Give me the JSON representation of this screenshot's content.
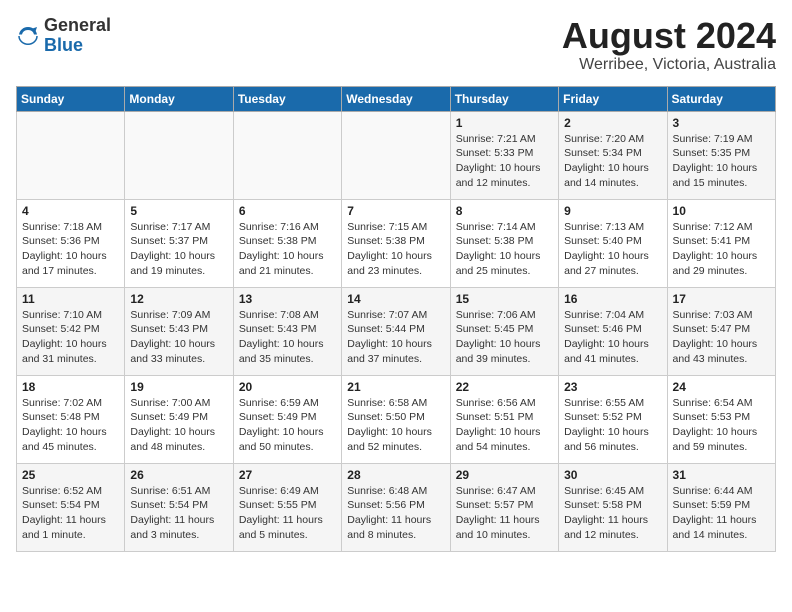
{
  "logo": {
    "general": "General",
    "blue": "Blue"
  },
  "header": {
    "month": "August 2024",
    "location": "Werribee, Victoria, Australia"
  },
  "weekdays": [
    "Sunday",
    "Monday",
    "Tuesday",
    "Wednesday",
    "Thursday",
    "Friday",
    "Saturday"
  ],
  "weeks": [
    [
      {
        "day": "",
        "info": ""
      },
      {
        "day": "",
        "info": ""
      },
      {
        "day": "",
        "info": ""
      },
      {
        "day": "",
        "info": ""
      },
      {
        "day": "1",
        "info": "Sunrise: 7:21 AM\nSunset: 5:33 PM\nDaylight: 10 hours\nand 12 minutes."
      },
      {
        "day": "2",
        "info": "Sunrise: 7:20 AM\nSunset: 5:34 PM\nDaylight: 10 hours\nand 14 minutes."
      },
      {
        "day": "3",
        "info": "Sunrise: 7:19 AM\nSunset: 5:35 PM\nDaylight: 10 hours\nand 15 minutes."
      }
    ],
    [
      {
        "day": "4",
        "info": "Sunrise: 7:18 AM\nSunset: 5:36 PM\nDaylight: 10 hours\nand 17 minutes."
      },
      {
        "day": "5",
        "info": "Sunrise: 7:17 AM\nSunset: 5:37 PM\nDaylight: 10 hours\nand 19 minutes."
      },
      {
        "day": "6",
        "info": "Sunrise: 7:16 AM\nSunset: 5:38 PM\nDaylight: 10 hours\nand 21 minutes."
      },
      {
        "day": "7",
        "info": "Sunrise: 7:15 AM\nSunset: 5:38 PM\nDaylight: 10 hours\nand 23 minutes."
      },
      {
        "day": "8",
        "info": "Sunrise: 7:14 AM\nSunset: 5:38 PM\nDaylight: 10 hours\nand 25 minutes."
      },
      {
        "day": "9",
        "info": "Sunrise: 7:13 AM\nSunset: 5:40 PM\nDaylight: 10 hours\nand 27 minutes."
      },
      {
        "day": "10",
        "info": "Sunrise: 7:12 AM\nSunset: 5:41 PM\nDaylight: 10 hours\nand 29 minutes."
      }
    ],
    [
      {
        "day": "11",
        "info": "Sunrise: 7:10 AM\nSunset: 5:42 PM\nDaylight: 10 hours\nand 31 minutes."
      },
      {
        "day": "12",
        "info": "Sunrise: 7:09 AM\nSunset: 5:43 PM\nDaylight: 10 hours\nand 33 minutes."
      },
      {
        "day": "13",
        "info": "Sunrise: 7:08 AM\nSunset: 5:43 PM\nDaylight: 10 hours\nand 35 minutes."
      },
      {
        "day": "14",
        "info": "Sunrise: 7:07 AM\nSunset: 5:44 PM\nDaylight: 10 hours\nand 37 minutes."
      },
      {
        "day": "15",
        "info": "Sunrise: 7:06 AM\nSunset: 5:45 PM\nDaylight: 10 hours\nand 39 minutes."
      },
      {
        "day": "16",
        "info": "Sunrise: 7:04 AM\nSunset: 5:46 PM\nDaylight: 10 hours\nand 41 minutes."
      },
      {
        "day": "17",
        "info": "Sunrise: 7:03 AM\nSunset: 5:47 PM\nDaylight: 10 hours\nand 43 minutes."
      }
    ],
    [
      {
        "day": "18",
        "info": "Sunrise: 7:02 AM\nSunset: 5:48 PM\nDaylight: 10 hours\nand 45 minutes."
      },
      {
        "day": "19",
        "info": "Sunrise: 7:00 AM\nSunset: 5:49 PM\nDaylight: 10 hours\nand 48 minutes."
      },
      {
        "day": "20",
        "info": "Sunrise: 6:59 AM\nSunset: 5:49 PM\nDaylight: 10 hours\nand 50 minutes."
      },
      {
        "day": "21",
        "info": "Sunrise: 6:58 AM\nSunset: 5:50 PM\nDaylight: 10 hours\nand 52 minutes."
      },
      {
        "day": "22",
        "info": "Sunrise: 6:56 AM\nSunset: 5:51 PM\nDaylight: 10 hours\nand 54 minutes."
      },
      {
        "day": "23",
        "info": "Sunrise: 6:55 AM\nSunset: 5:52 PM\nDaylight: 10 hours\nand 56 minutes."
      },
      {
        "day": "24",
        "info": "Sunrise: 6:54 AM\nSunset: 5:53 PM\nDaylight: 10 hours\nand 59 minutes."
      }
    ],
    [
      {
        "day": "25",
        "info": "Sunrise: 6:52 AM\nSunset: 5:54 PM\nDaylight: 11 hours\nand 1 minute."
      },
      {
        "day": "26",
        "info": "Sunrise: 6:51 AM\nSunset: 5:54 PM\nDaylight: 11 hours\nand 3 minutes."
      },
      {
        "day": "27",
        "info": "Sunrise: 6:49 AM\nSunset: 5:55 PM\nDaylight: 11 hours\nand 5 minutes."
      },
      {
        "day": "28",
        "info": "Sunrise: 6:48 AM\nSunset: 5:56 PM\nDaylight: 11 hours\nand 8 minutes."
      },
      {
        "day": "29",
        "info": "Sunrise: 6:47 AM\nSunset: 5:57 PM\nDaylight: 11 hours\nand 10 minutes."
      },
      {
        "day": "30",
        "info": "Sunrise: 6:45 AM\nSunset: 5:58 PM\nDaylight: 11 hours\nand 12 minutes."
      },
      {
        "day": "31",
        "info": "Sunrise: 6:44 AM\nSunset: 5:59 PM\nDaylight: 11 hours\nand 14 minutes."
      }
    ]
  ]
}
